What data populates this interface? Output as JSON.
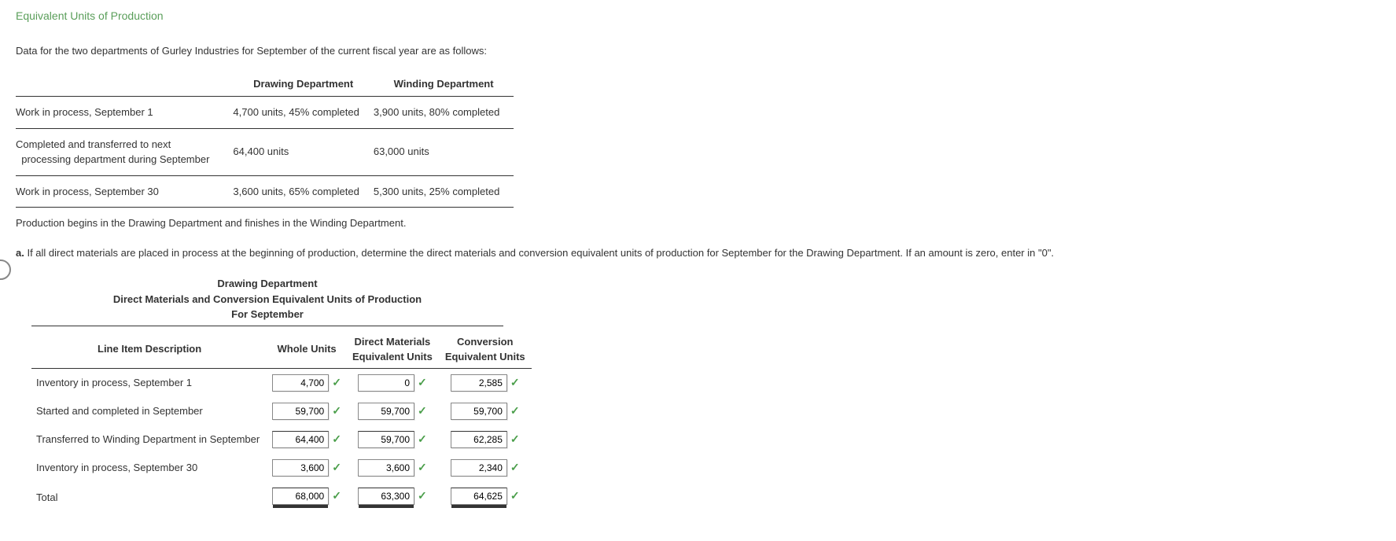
{
  "title": "Equivalent Units of Production",
  "intro": "Data for the two departments of Gurley Industries for September of the current fiscal year are as follows:",
  "dataTable": {
    "col1": "Drawing Department",
    "col2": "Winding Department",
    "rows": [
      {
        "label": "Work in process, September 1",
        "c1": "4,700 units, 45% completed",
        "c2": "3,900 units, 80% completed"
      },
      {
        "label": "Completed and transferred to next processing department during September",
        "c1": "64,400 units",
        "c2": "63,000 units"
      },
      {
        "label": "Work in process, September 30",
        "c1": "3,600 units, 65% completed",
        "c2": "5,300 units, 25% completed"
      }
    ]
  },
  "note": "Production begins in the Drawing Department and finishes in the Winding Department.",
  "question": {
    "letter": "a.",
    "text": "  If all direct materials are placed in process at the beginning of production, determine the direct materials and conversion equivalent units of production for September for the Drawing Department. If an amount is zero, enter in \"0\"."
  },
  "answer": {
    "titleLines": [
      "Drawing Department",
      "Direct Materials and Conversion Equivalent Units of Production",
      "For September"
    ],
    "headers": [
      "Line Item Description",
      "Whole Units",
      "Direct Materials Equivalent Units",
      "Conversion Equivalent Units"
    ],
    "rows": [
      {
        "desc": "Inventory in process, September 1",
        "v": [
          "4,700",
          "0",
          "2,585"
        ]
      },
      {
        "desc": "Started and completed in September",
        "v": [
          "59,700",
          "59,700",
          "59,700"
        ]
      },
      {
        "desc": "Transferred to Winding Department in September",
        "v": [
          "64,400",
          "59,700",
          "62,285"
        ]
      },
      {
        "desc": "Inventory in process, September 30",
        "v": [
          "3,600",
          "3,600",
          "2,340"
        ]
      },
      {
        "desc": "Total",
        "v": [
          "68,000",
          "63,300",
          "64,625"
        ]
      }
    ]
  }
}
